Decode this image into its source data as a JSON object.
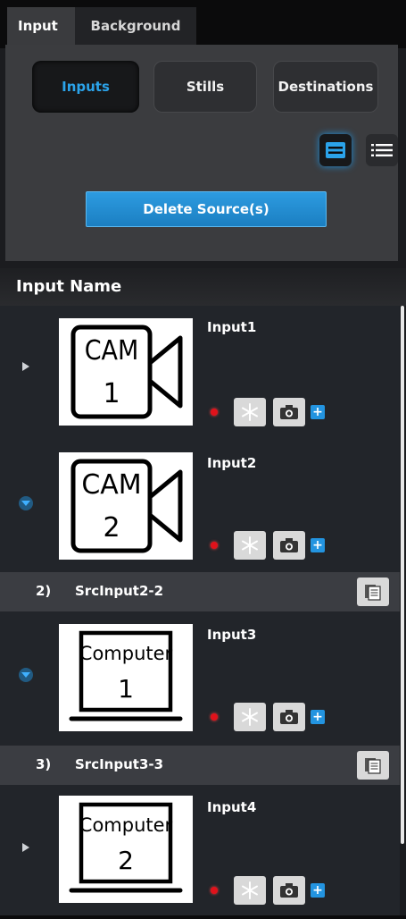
{
  "tabs": [
    {
      "label": "Input"
    },
    {
      "label": "Background"
    }
  ],
  "segments": {
    "inputs": "Inputs",
    "stills": "Stills",
    "destinations": "Destinations",
    "selected": "Inputs"
  },
  "view_modes": {
    "selected": "grid"
  },
  "delete_button": "Delete Source(s)",
  "column_header": "Input Name",
  "inputs": [
    {
      "name": "Input1",
      "thumb_lines": [
        "CAM",
        "1"
      ],
      "expanded": false
    },
    {
      "name": "Input2",
      "thumb_lines": [
        "CAM",
        "2"
      ],
      "expanded": true
    },
    {
      "name": "Input3",
      "thumb_lines": [
        "Computer",
        "1"
      ],
      "expanded": true
    },
    {
      "name": "Input4",
      "thumb_lines": [
        "Computer",
        "2"
      ],
      "expanded": false
    }
  ],
  "sources": [
    {
      "num": "2)",
      "name": "SrcInput2-2"
    },
    {
      "num": "3)",
      "name": "SrcInput3-3"
    }
  ],
  "plus_label": "+",
  "colors": {
    "accent": "#2ba3ea",
    "live_dot": "#e0121b",
    "button_blue": "#1b7fc2"
  }
}
